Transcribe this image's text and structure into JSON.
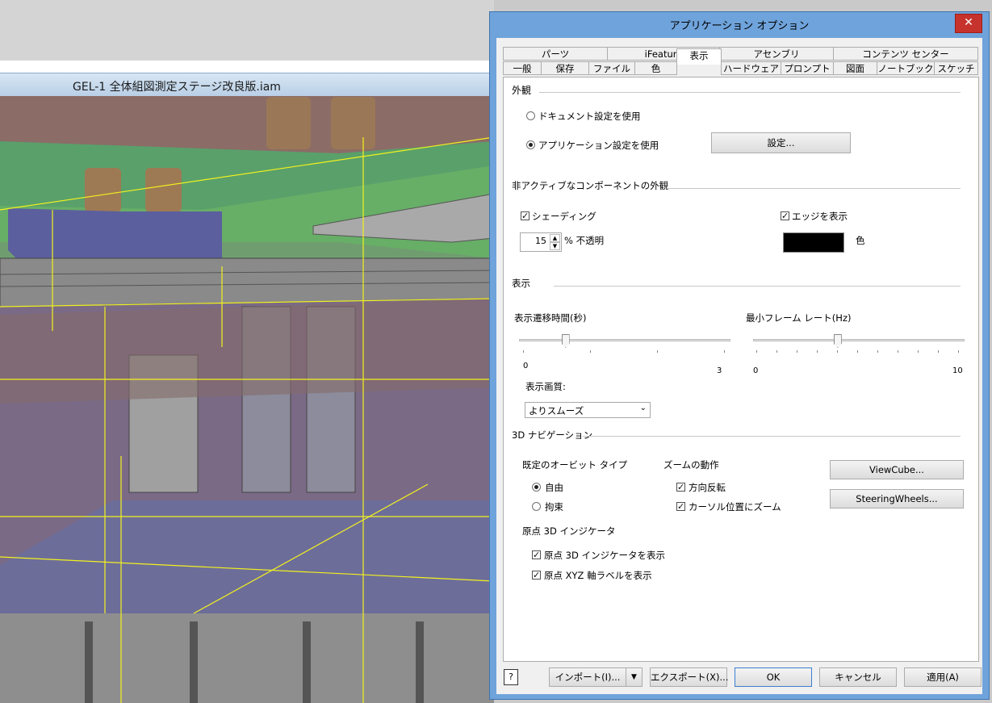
{
  "cad": {
    "document_title": "GEL-1 全体組図測定ステージ改良版.iam"
  },
  "dialog": {
    "title": "アプリケーション オプション",
    "close_glyph": "✕",
    "tabs_row1": [
      "パーツ",
      "iFeature",
      "アセンブリ",
      "コンテンツ センター"
    ],
    "tabs_row2": [
      "一般",
      "保存",
      "ファイル",
      "色",
      "表示",
      "ハードウェア",
      "プロンプト",
      "図面",
      "ノートブック",
      "スケッチ"
    ],
    "active_tab": "表示"
  },
  "appearance": {
    "heading": "外観",
    "opt_document": "ドキュメント設定を使用",
    "opt_application": "アプリケーション設定を使用",
    "selected": "application",
    "settings_button": "設定..."
  },
  "inactive": {
    "heading": "非アクティブなコンポーネントの外観",
    "shading_label": "シェーディング",
    "shading_checked": true,
    "opacity_value": "15",
    "opacity_label": "% 不透明",
    "edges_label": "エッジを表示",
    "edges_checked": true,
    "color_label": "色",
    "edge_color": "#000000"
  },
  "display": {
    "heading": "表示",
    "transition_label": "表示遷移時間(秒)",
    "transition_min": "0",
    "transition_max": "3",
    "transition_value_fraction": 0.22,
    "framerate_label": "最小フレーム レート(Hz)",
    "framerate_min": "0",
    "framerate_max": "10",
    "framerate_value_fraction": 0.4,
    "quality_label": "表示画質:",
    "quality_value": "よりスムーズ"
  },
  "navigation": {
    "heading": "3D ナビゲーション",
    "orbit_heading": "既定のオービット タイプ",
    "orbit_free": "自由",
    "orbit_constrained": "拘束",
    "orbit_selected": "free",
    "zoom_heading": "ズームの動作",
    "zoom_reverse": "方向反転",
    "zoom_reverse_checked": true,
    "zoom_cursor": "カーソル位置にズーム",
    "zoom_cursor_checked": true,
    "viewcube_button": "ViewCube...",
    "steering_button": "SteeringWheels...",
    "origin_heading": "原点 3D インジケータ",
    "origin_show": "原点 3D インジケータを表示",
    "origin_show_checked": true,
    "origin_xyz": "原点 XYZ 軸ラベルを表示",
    "origin_xyz_checked": true
  },
  "footer": {
    "help_glyph": "?",
    "import_button": "インポート(I)...",
    "export_button": "エクスポート(X)...",
    "ok_button": "OK",
    "cancel_button": "キャンセル",
    "apply_button": "適用(A)"
  }
}
